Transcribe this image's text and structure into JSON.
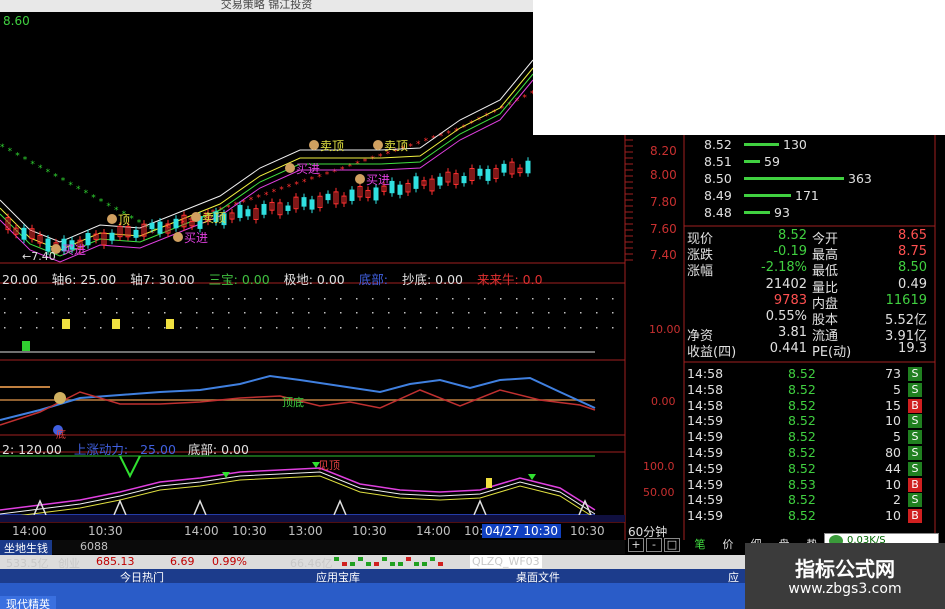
{
  "window": {
    "title": "交易策略 锦江投资",
    "top_left_price": "8.60"
  },
  "main_chart": {
    "price_labels": [
      "8.20",
      "8.00",
      "7.80",
      "7.60",
      "7.40"
    ],
    "low_label": "←7.40",
    "annotations": [
      {
        "text": "买进",
        "color": "#e040e0"
      },
      {
        "text": "顶",
        "color": "#e0e040"
      },
      {
        "text": "买进",
        "color": "#e040e0"
      },
      {
        "text": "卖顶",
        "color": "#e0e040"
      },
      {
        "text": "买进",
        "color": "#e040e0"
      },
      {
        "text": "卖顶",
        "color": "#e0e040"
      },
      {
        "text": "买进",
        "color": "#e040e0"
      },
      {
        "text": "卖顶",
        "color": "#e0e040"
      }
    ]
  },
  "indicator1": {
    "items": [
      {
        "label": "20.00",
        "color": "#e0e0e0"
      },
      {
        "label": "轴6: 25.00",
        "color": "#e0e0e0"
      },
      {
        "label": "轴7: 30.00",
        "color": "#e0e0e0"
      },
      {
        "label": "三宝: 0.00",
        "color": "#40c040"
      },
      {
        "label": "极地: 0.00",
        "color": "#e0e0e0"
      },
      {
        "label": "底部:",
        "color": "#4060e0"
      },
      {
        "label": "抄底: 0.00",
        "color": "#e0e0e0"
      },
      {
        "label": "来来牛: 0.0",
        "color": "#e03030"
      }
    ]
  },
  "indicator2": {
    "y_label": "10.00"
  },
  "indicator3": {
    "y_label": "0.00",
    "tag1": "顶底",
    "tag2": "底"
  },
  "indicator4": {
    "items": [
      {
        "label": "2: 120.00",
        "color": "#e0e0e0"
      },
      {
        "label": "上涨动力:",
        "color": "#4060e0"
      },
      {
        "label": "25.00",
        "color": "#4060e0"
      },
      {
        "label": "底部: 0.00",
        "color": "#e0e0e0"
      }
    ],
    "y_labels": [
      "100.0",
      "50.00"
    ],
    "tag": "见顶"
  },
  "time_axis": {
    "labels": [
      "14:00",
      "10:30",
      "14:00",
      "10:30",
      "13:00",
      "10:30",
      "14:00",
      "10:30",
      "14:00",
      "10:30"
    ],
    "highlight": "04/27 10:30",
    "period": "60分钟"
  },
  "quote": {
    "asks": [
      {
        "price": "8.52",
        "vol": "130",
        "bar": 0.35
      },
      {
        "price": "8.51",
        "vol": "59",
        "bar": 0.16
      },
      {
        "price": "8.50",
        "vol": "363",
        "bar": 1.0
      },
      {
        "price": "8.49",
        "vol": "171",
        "bar": 0.47
      },
      {
        "price": "8.48",
        "vol": "93",
        "bar": 0.26
      }
    ],
    "rows": [
      {
        "k1": "现价",
        "v1": "8.52",
        "c1": "#40d040",
        "k2": "今开",
        "v2": "8.65",
        "c2": "#ff5050"
      },
      {
        "k1": "涨跌",
        "v1": "-0.19",
        "c1": "#40d040",
        "k2": "最高",
        "v2": "8.75",
        "c2": "#ff5050"
      },
      {
        "k1": "涨幅",
        "v1": "-2.18%",
        "c1": "#40d040",
        "k2": "最低",
        "v2": "8.50",
        "c2": "#40d040"
      },
      {
        "k1": "",
        "v1": "21402",
        "c1": "#e0e0e0",
        "k2": "量比",
        "v2": "0.49",
        "c2": "#e0e0e0"
      },
      {
        "k1": "",
        "v1": "9783",
        "c1": "#ff5050",
        "k2": "内盘",
        "v2": "11619",
        "c2": "#40d040"
      },
      {
        "k1": "",
        "v1": "0.55%",
        "c1": "#e0e0e0",
        "k2": "股本",
        "v2": "5.52亿",
        "c2": "#e0e0e0"
      },
      {
        "k1": "净资",
        "v1": "3.81",
        "c1": "#e0e0e0",
        "k2": "流通",
        "v2": "3.91亿",
        "c2": "#e0e0e0"
      },
      {
        "k1": "收益(四)",
        "v1": "0.441",
        "c1": "#e0e0e0",
        "k2": "PE(动)",
        "v2": "19.3",
        "c2": "#e0e0e0"
      }
    ],
    "ticks": [
      {
        "time": "14:58",
        "price": "8.52",
        "vol": "73",
        "side": "S"
      },
      {
        "time": "14:58",
        "price": "8.52",
        "vol": "5",
        "side": "S"
      },
      {
        "time": "14:58",
        "price": "8.52",
        "vol": "15",
        "side": "B"
      },
      {
        "time": "14:59",
        "price": "8.52",
        "vol": "10",
        "side": "S"
      },
      {
        "time": "14:59",
        "price": "8.52",
        "vol": "5",
        "side": "S"
      },
      {
        "time": "14:59",
        "price": "8.52",
        "vol": "80",
        "side": "S"
      },
      {
        "time": "14:59",
        "price": "8.52",
        "vol": "44",
        "side": "S"
      },
      {
        "time": "14:59",
        "price": "8.53",
        "vol": "10",
        "side": "B"
      },
      {
        "time": "14:59",
        "price": "8.52",
        "vol": "2",
        "side": "S"
      },
      {
        "time": "14:59",
        "price": "8.52",
        "vol": "10",
        "side": "B"
      }
    ]
  },
  "bottom": {
    "tabs_left": [
      "坐地生钱",
      "6088"
    ],
    "nav_buttons": [
      "+",
      "-",
      "□"
    ],
    "right_tabs": [
      "笔",
      "价",
      "细",
      "盘",
      "势"
    ],
    "speed": "0.03K/S",
    "status": [
      {
        "text": "533.5亿",
        "color": "#000"
      },
      {
        "text": "创业",
        "color": "#000"
      },
      {
        "text": "685.13",
        "color": "#c00000"
      },
      {
        "text": "6.69",
        "color": "#c00000"
      },
      {
        "text": "0.99%",
        "color": "#c00000"
      },
      {
        "text": "66.46亿",
        "color": "#000"
      },
      {
        "text": "QLZQ_WF03",
        "color": "#000"
      }
    ],
    "menu": [
      "今日热门",
      "应用宝库",
      "桌面文件",
      "应"
    ],
    "taskbar_item": "现代精英"
  },
  "watermark": {
    "line1": "指标公式网",
    "line2": "www.zbgs3.com"
  }
}
